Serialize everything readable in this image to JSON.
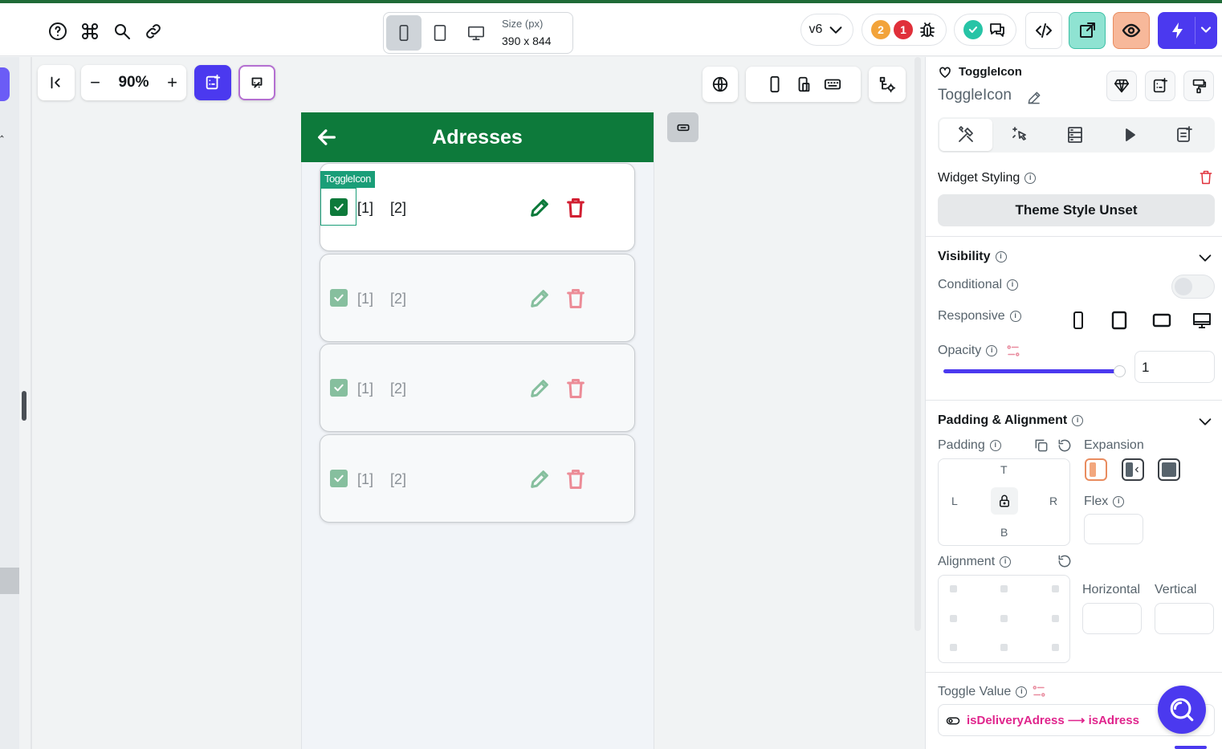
{
  "topbar": {
    "help_icon": "help-circle-icon",
    "command_icon": "command-icon",
    "search_icon": "search-icon",
    "link_icon": "link-icon",
    "size_label": "Size (px)",
    "size_value": "390 x 844",
    "version": "v6",
    "warnings_count": "2",
    "errors_count": "1"
  },
  "canvas_toolbar": {
    "zoom": "90%"
  },
  "phone": {
    "appbar_title": "Adresses",
    "selected_widget_tag": "ToggleIcon",
    "cards": [
      {
        "label1": "[1]",
        "label2": "[2]"
      },
      {
        "label1": "[1]",
        "label2": "[2]"
      },
      {
        "label1": "[1]",
        "label2": "[2]"
      },
      {
        "label1": "[1]",
        "label2": "[2]"
      }
    ]
  },
  "panel": {
    "widget_type": "ToggleIcon",
    "widget_name": "ToggleIcon",
    "widget_styling_label": "Widget Styling",
    "theme_style_button": "Theme Style Unset",
    "visibility_label": "Visibility",
    "conditional_label": "Conditional",
    "responsive_label": "Responsive",
    "opacity_label": "Opacity",
    "opacity_value": "1",
    "opacity_fraction": 1.0,
    "padding_alignment_label": "Padding & Alignment",
    "padding_label": "Padding",
    "expansion_label": "Expansion",
    "pad_t": "T",
    "pad_l": "L",
    "pad_r": "R",
    "pad_b": "B",
    "flex_label": "Flex",
    "alignment_label": "Alignment",
    "horizontal_label": "Horizontal",
    "vertical_label": "Vertical",
    "toggle_value_label": "Toggle Value",
    "toggle_value_binding": "isDeliveryAdress ⟶ isAdress"
  },
  "colors": {
    "appbar": "#0d7a3b",
    "accent": "#4b39ef",
    "danger": "#d21f32",
    "binding": "#e0248c"
  }
}
